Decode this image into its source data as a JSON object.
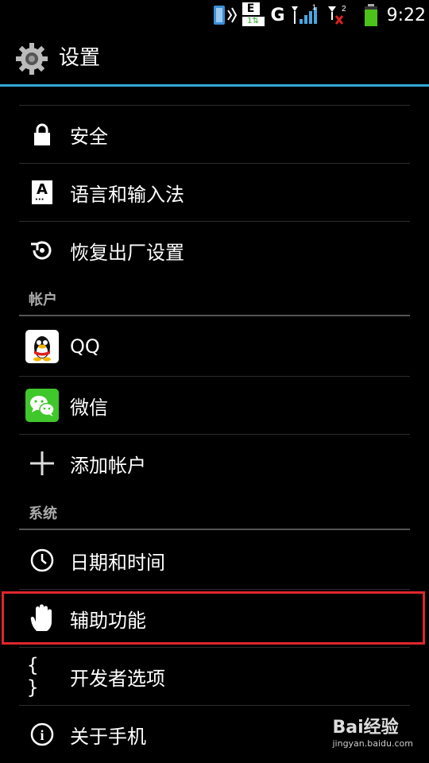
{
  "status_bar": {
    "network_type": "G",
    "mobile_data": "E",
    "sim2_label": "2",
    "time": "9:22"
  },
  "action_bar": {
    "title": "设置",
    "accent_color": "#33a8d8"
  },
  "items_top": [
    {
      "label": "安全",
      "icon": "lock-icon"
    },
    {
      "label": "语言和输入法",
      "icon": "keyboard-icon"
    },
    {
      "label": "恢复出厂设置",
      "icon": "restore-icon"
    }
  ],
  "section_accounts": "帐户",
  "items_accounts": [
    {
      "label": "QQ",
      "icon": "qq-penguin-icon"
    },
    {
      "label": "微信",
      "icon": "wechat-icon"
    },
    {
      "label": "添加帐户",
      "icon": "plus-icon"
    }
  ],
  "section_system": "系统",
  "items_system": [
    {
      "label": "日期和时间",
      "icon": "clock-icon"
    },
    {
      "label": "辅助功能",
      "icon": "hand-icon",
      "highlighted": true
    },
    {
      "label": "开发者选项",
      "icon": "braces-icon"
    },
    {
      "label": "关于手机",
      "icon": "info-icon"
    }
  ],
  "icon_glyphs": {
    "keyboard": "A",
    "braces": "{ }",
    "info": "i"
  },
  "highlight_color": "#e0262b",
  "watermark": {
    "brand": "Bai经验",
    "url": "jingyan.baidu.com"
  }
}
